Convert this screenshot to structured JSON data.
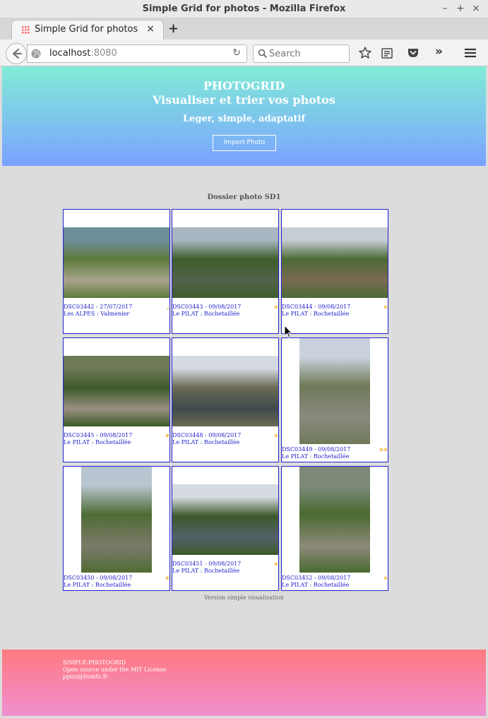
{
  "window": {
    "title": "Simple Grid for photos - Mozilla Firefox",
    "minimize": "–",
    "maximize": "+",
    "close": "×"
  },
  "tabs": [
    {
      "label": "Simple Grid for photos",
      "close": "×"
    }
  ],
  "new_tab_label": "+",
  "toolbar": {
    "url_host": "localhost",
    "url_port": ":8080",
    "reload": "↻",
    "search_placeholder": "Search",
    "overflow": "»"
  },
  "header": {
    "brand": "PHOTOGRID",
    "tagline": "Visualiser et trier vos photos",
    "subtitle": "Leger, simple, adaptatif",
    "import_label": "Import Photo"
  },
  "folder_title": "Dossier photo SD1",
  "photos": [
    {
      "name": "DSC03442 - 27/07/2017",
      "location": "Les ALPES : Valmenier",
      "stars": "-",
      "orientation": "landscape",
      "colors": [
        "#6d8f9a",
        "#5f7a3d",
        "#a7a48a"
      ]
    },
    {
      "name": "DSC03443 - 09/08/2017",
      "location": "Le PILAT : Rochetaillée",
      "stars": "*",
      "orientation": "landscape",
      "colors": [
        "#a9b7c2",
        "#3f5e2d",
        "#52614a"
      ]
    },
    {
      "name": "DSC03444 - 09/08/2017",
      "location": "Le PILAT : Rochetaillée",
      "stars": "*",
      "orientation": "landscape",
      "colors": [
        "#c6cdd4",
        "#4c6b35",
        "#7a6a52"
      ]
    },
    {
      "name": "DSC03445 - 09/08/2017",
      "location": "Le PILAT : Rochetaillée",
      "stars": "*",
      "orientation": "landscape",
      "colors": [
        "#6e7a58",
        "#3c5a2a",
        "#9a8f80"
      ]
    },
    {
      "name": "DSC03448 - 09/08/2017",
      "location": "Le PILAT : Rochetaillée",
      "stars": "*",
      "orientation": "landscape",
      "colors": [
        "#d4dae0",
        "#6b6a55",
        "#3e4a4c"
      ]
    },
    {
      "name": "DSC03449 - 09/08/2017",
      "location": "Le PILAT : Rochetaillée",
      "stars": "**",
      "orientation": "portrait",
      "colors": [
        "#c9d2dc",
        "#6f7a58",
        "#8a8a80"
      ]
    },
    {
      "name": "DSC03450 - 09/08/2017",
      "location": "Le PILAT : Rochetaillée",
      "stars": "*",
      "orientation": "portrait",
      "colors": [
        "#b8c4cf",
        "#4f6c34",
        "#7b7a6a"
      ]
    },
    {
      "name": "DSC03451 - 09/08/2017",
      "location": "Le PILAT : Rochetaillée",
      "stars": "*",
      "orientation": "landscape",
      "colors": [
        "#d5dbe1",
        "#3d5a2a",
        "#52606a"
      ]
    },
    {
      "name": "DSC03452 - 09/08/2017",
      "location": "Le PILAT : Rochetaillée",
      "stars": "*",
      "orientation": "portrait",
      "colors": [
        "#7d8a7a",
        "#4a6a30",
        "#8e8a7a"
      ]
    }
  ],
  "version_text": "Version simple visualisation",
  "footer": {
    "line1": "SIMPLE-PHOTOGRID",
    "line2": "Open source under the MIT License",
    "line3": "ppizz@livinfo.fr"
  },
  "accent": {
    "card_border": "#2222cc",
    "stars": "#f5a000"
  }
}
